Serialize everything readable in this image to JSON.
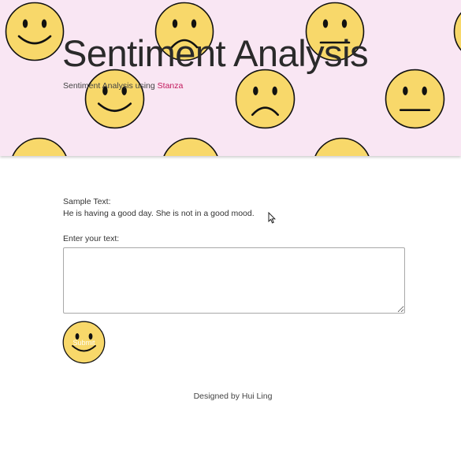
{
  "header": {
    "title": "Sentiment Analysis",
    "subtitle_prefix": "Sentiment Analysis using ",
    "subtitle_link": "Stanza"
  },
  "background_faces": [
    {
      "mood": "happy"
    },
    {
      "mood": "sad"
    },
    {
      "mood": "neutral"
    },
    {
      "mood": "partial"
    },
    {
      "mood": "happy"
    },
    {
      "mood": "sad"
    },
    {
      "mood": "neutral"
    },
    {
      "mood": "happy"
    },
    {
      "mood": "happy"
    },
    {
      "mood": "happy"
    }
  ],
  "main": {
    "sample_label": "Sample Text:",
    "sample_text": "He is having a good day. She is not in a good mood.",
    "input_label": "Enter your text:",
    "input_value": "",
    "submit_label": "Submit"
  },
  "footer": {
    "text": "Designed by Hui Ling"
  },
  "colors": {
    "hero_bg": "#f9e6f3",
    "face_fill": "#f8d86a",
    "face_stroke": "#111111",
    "link": "#c2185b"
  },
  "icons": {
    "face_happy": "smiley-happy-icon",
    "face_sad": "smiley-sad-icon",
    "face_neutral": "smiley-neutral-icon",
    "submit": "smiley-happy-icon",
    "cursor": "mouse-pointer-icon"
  }
}
